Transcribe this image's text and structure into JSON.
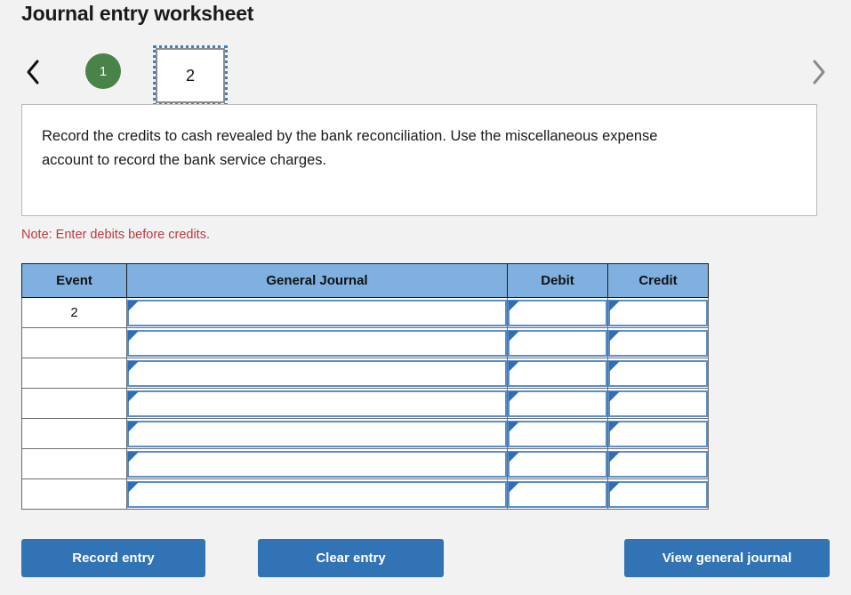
{
  "page_title": "Journal entry worksheet",
  "pager": {
    "prev_icon": "chevron-left-icon",
    "next_icon": "chevron-right-icon",
    "pages": [
      {
        "label": "1",
        "state": "completed"
      },
      {
        "label": "2",
        "state": "selected"
      }
    ]
  },
  "instruction": {
    "text": "Record the credits to cash revealed by the bank reconciliation. Use the miscellaneous expense account to record the bank service charges."
  },
  "note": "Note: Enter debits before credits.",
  "table": {
    "headers": [
      "Event",
      "General Journal",
      "Debit",
      "Credit"
    ],
    "rows": [
      {
        "event": "2",
        "journal": "",
        "debit": "",
        "credit": ""
      },
      {
        "event": "",
        "journal": "",
        "debit": "",
        "credit": ""
      },
      {
        "event": "",
        "journal": "",
        "debit": "",
        "credit": ""
      },
      {
        "event": "",
        "journal": "",
        "debit": "",
        "credit": ""
      },
      {
        "event": "",
        "journal": "",
        "debit": "",
        "credit": ""
      },
      {
        "event": "",
        "journal": "",
        "debit": "",
        "credit": ""
      },
      {
        "event": "",
        "journal": "",
        "debit": "",
        "credit": ""
      }
    ]
  },
  "buttons": {
    "record": "Record entry",
    "clear": "Clear entry",
    "view": "View general journal"
  },
  "colors": {
    "page_bg": "#f2f2f2",
    "header_blue": "#7fb0e0",
    "button_blue": "#3273b5",
    "bubble_green": "#4a8348",
    "note_red": "#bb3b42",
    "focus_blue": "#3f7fc1",
    "field_border_blue": "#5b8fc9"
  }
}
